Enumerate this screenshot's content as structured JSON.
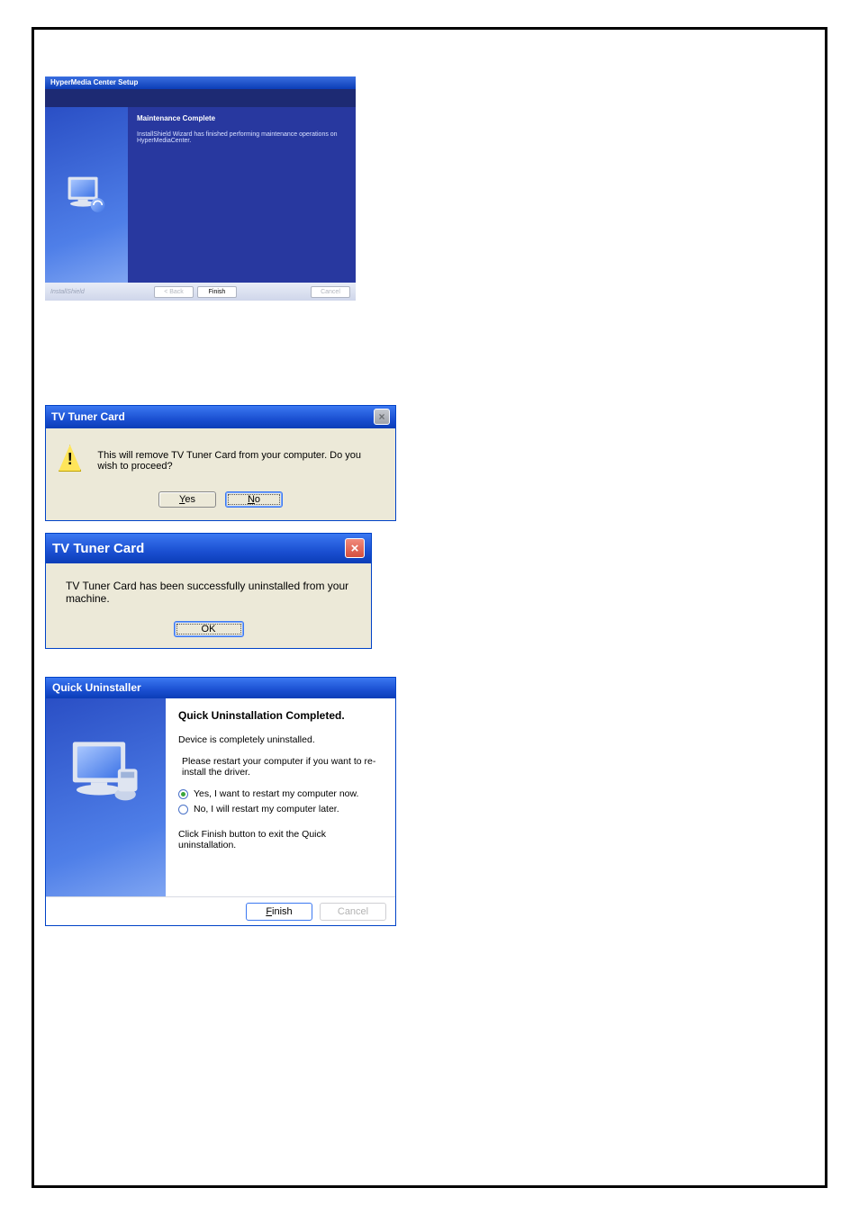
{
  "dlg1": {
    "title": "HyperMedia Center Setup",
    "heading": "Maintenance Complete",
    "body": "InstallShield Wizard has finished performing maintenance operations on HyperMediaCenter.",
    "brand": "InstallShield",
    "back": "< Back",
    "finish": "Finish",
    "cancel": "Cancel"
  },
  "dlg2": {
    "title": "TV Tuner Card",
    "message": "This will remove TV Tuner Card from your computer. Do you wish to proceed?",
    "yes_prefix": "Y",
    "yes_rest": "es",
    "no_prefix": "N",
    "no_rest": "o"
  },
  "dlg3": {
    "title": "TV Tuner Card",
    "message": "TV Tuner Card has been successfully uninstalled from your machine.",
    "ok": "OK"
  },
  "dlg4": {
    "title": "Quick Uninstaller",
    "heading": "Quick Uninstallation Completed.",
    "line1": "Device is completely uninstalled.",
    "line2": "Please restart your computer if you want to re-install the driver.",
    "opt_yes": "Yes, I want to restart my computer now.",
    "opt_no": "No, I will restart my computer later.",
    "line3": "Click Finish button to exit the Quick uninstallation.",
    "finish_prefix": "F",
    "finish_rest": "inish",
    "cancel": "Cancel"
  }
}
